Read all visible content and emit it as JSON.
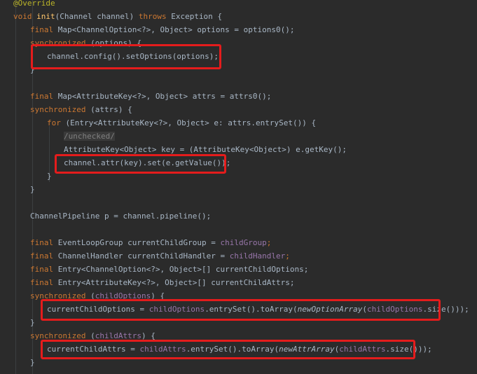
{
  "lines": [
    {
      "indent": 0,
      "tokens": [
        {
          "t": "@Override",
          "c": "ann"
        }
      ]
    },
    {
      "indent": 0,
      "tokens": [
        {
          "t": "void ",
          "c": "kw"
        },
        {
          "t": "init",
          "c": "fn"
        },
        {
          "t": "(Channel channel) ",
          "c": ""
        },
        {
          "t": "throws ",
          "c": "kw"
        },
        {
          "t": "Exception {",
          "c": ""
        }
      ]
    },
    {
      "indent": 1,
      "tokens": [
        {
          "t": "final ",
          "c": "kw"
        },
        {
          "t": "Map<ChannelOption<?>, Object> options = options0();",
          "c": ""
        }
      ]
    },
    {
      "indent": 1,
      "tokens": [
        {
          "t": "synchronized ",
          "c": "kw"
        },
        {
          "t": "(options) {",
          "c": ""
        }
      ]
    },
    {
      "indent": 2,
      "tokens": [
        {
          "t": "channel.config().setOptions(options);",
          "c": ""
        }
      ]
    },
    {
      "indent": 1,
      "tokens": [
        {
          "t": "}",
          "c": ""
        }
      ]
    },
    {
      "indent": 0,
      "tokens": []
    },
    {
      "indent": 1,
      "tokens": [
        {
          "t": "final ",
          "c": "kw"
        },
        {
          "t": "Map<AttributeKey<?>, Object> attrs = attrs0();",
          "c": ""
        }
      ]
    },
    {
      "indent": 1,
      "tokens": [
        {
          "t": "synchronized ",
          "c": "kw"
        },
        {
          "t": "(attrs) {",
          "c": ""
        }
      ]
    },
    {
      "indent": 2,
      "tokens": [
        {
          "t": "for ",
          "c": "kw"
        },
        {
          "t": "(Entry<AttributeKey<?>, Object> e: attrs.entrySet()) {",
          "c": ""
        }
      ]
    },
    {
      "indent": 3,
      "tokens": [
        {
          "t": "/unchecked/",
          "c": "cmt cmtbg"
        }
      ]
    },
    {
      "indent": 3,
      "tokens": [
        {
          "t": "AttributeKey<Object> key = (AttributeKey<Object>) e.getKey();",
          "c": ""
        }
      ]
    },
    {
      "indent": 3,
      "tokens": [
        {
          "t": "channel.attr(key).set(e.getValue());",
          "c": ""
        }
      ]
    },
    {
      "indent": 2,
      "tokens": [
        {
          "t": "}",
          "c": ""
        }
      ]
    },
    {
      "indent": 1,
      "tokens": [
        {
          "t": "}",
          "c": ""
        }
      ]
    },
    {
      "indent": 0,
      "tokens": []
    },
    {
      "indent": 1,
      "tokens": [
        {
          "t": "ChannelPipeline p = channel.pipeline();",
          "c": ""
        }
      ]
    },
    {
      "indent": 0,
      "tokens": []
    },
    {
      "indent": 1,
      "tokens": [
        {
          "t": "final ",
          "c": "kw"
        },
        {
          "t": "EventLoopGroup currentChildGroup = ",
          "c": ""
        },
        {
          "t": "childGroup",
          "c": "fld"
        },
        {
          "t": ";",
          "c": "punc"
        }
      ]
    },
    {
      "indent": 1,
      "tokens": [
        {
          "t": "final ",
          "c": "kw"
        },
        {
          "t": "ChannelHandler currentChildHandler = ",
          "c": ""
        },
        {
          "t": "childHandler",
          "c": "fld"
        },
        {
          "t": ";",
          "c": "punc"
        }
      ]
    },
    {
      "indent": 1,
      "tokens": [
        {
          "t": "final ",
          "c": "kw"
        },
        {
          "t": "Entry<ChannelOption<?>, Object>[] currentChildOptions;",
          "c": ""
        }
      ]
    },
    {
      "indent": 1,
      "tokens": [
        {
          "t": "final ",
          "c": "kw"
        },
        {
          "t": "Entry<AttributeKey<?>, Object>[] currentChildAttrs;",
          "c": ""
        }
      ]
    },
    {
      "indent": 1,
      "tokens": [
        {
          "t": "synchronized ",
          "c": "kw"
        },
        {
          "t": "(",
          "c": ""
        },
        {
          "t": "childOptions",
          "c": "fld"
        },
        {
          "t": ") {",
          "c": ""
        }
      ]
    },
    {
      "indent": 2,
      "tokens": [
        {
          "t": "currentChildOptions = ",
          "c": ""
        },
        {
          "t": "childOptions",
          "c": "fld"
        },
        {
          "t": ".entrySet().toArray(",
          "c": ""
        },
        {
          "t": "newOptionArray",
          "c": "it"
        },
        {
          "t": "(",
          "c": ""
        },
        {
          "t": "childOptions",
          "c": "fld"
        },
        {
          "t": ".size()));",
          "c": ""
        }
      ]
    },
    {
      "indent": 1,
      "tokens": [
        {
          "t": "}",
          "c": ""
        }
      ]
    },
    {
      "indent": 1,
      "tokens": [
        {
          "t": "synchronized ",
          "c": "kw"
        },
        {
          "t": "(",
          "c": ""
        },
        {
          "t": "childAttrs",
          "c": "fld"
        },
        {
          "t": ") {",
          "c": ""
        }
      ]
    },
    {
      "indent": 2,
      "tokens": [
        {
          "t": "currentChildAttrs = ",
          "c": ""
        },
        {
          "t": "childAttrs",
          "c": "fld"
        },
        {
          "t": ".entrySet().toArray(",
          "c": ""
        },
        {
          "t": "newAttrArray",
          "c": "it"
        },
        {
          "t": "(",
          "c": ""
        },
        {
          "t": "childAttrs",
          "c": "fld"
        },
        {
          "t": ".size()));",
          "c": ""
        }
      ]
    },
    {
      "indent": 1,
      "tokens": [
        {
          "t": "}",
          "c": ""
        }
      ]
    }
  ],
  "colors": {
    "background": "#2b2b2b",
    "text": "#a9b7c6",
    "keyword": "#cc7832",
    "annotation": "#bbb529",
    "method": "#ffc66d",
    "field": "#9876aa",
    "comment": "#808080",
    "highlight_box": "#e41c1c"
  }
}
